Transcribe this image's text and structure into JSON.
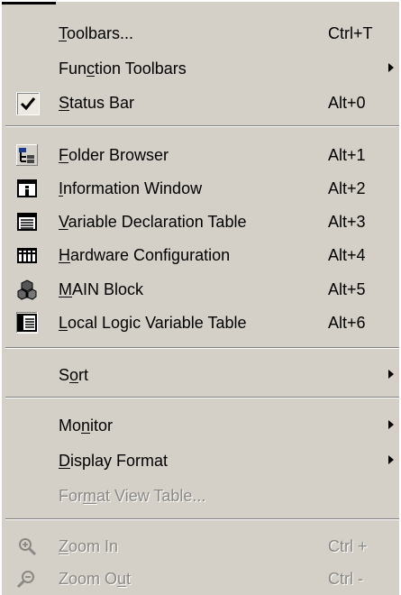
{
  "menu": {
    "items": [
      {
        "pre": "",
        "acc": "T",
        "post": "oolbars...",
        "shortcut": "Ctrl+T"
      },
      {
        "pre": "Fun",
        "acc": "c",
        "post": "tion Toolbars",
        "shortcut": ""
      },
      {
        "pre": "",
        "acc": "S",
        "post": "tatus Bar",
        "shortcut": "Alt+0"
      },
      {
        "pre": "",
        "acc": "F",
        "post": "older Browser",
        "shortcut": "Alt+1"
      },
      {
        "pre": "",
        "acc": "I",
        "post": "nformation Window",
        "shortcut": "Alt+2"
      },
      {
        "pre": "",
        "acc": "V",
        "post": "ariable Declaration Table",
        "shortcut": "Alt+3"
      },
      {
        "pre": "",
        "acc": "H",
        "post": "ardware Configuration",
        "shortcut": "Alt+4"
      },
      {
        "pre": "",
        "acc": "M",
        "post": "AIN Block",
        "shortcut": "Alt+5"
      },
      {
        "pre": "",
        "acc": "L",
        "post": "ocal Logic Variable Table",
        "shortcut": "Alt+6"
      },
      {
        "pre": "S",
        "acc": "o",
        "post": "rt",
        "shortcut": ""
      },
      {
        "pre": "Mo",
        "acc": "n",
        "post": "itor",
        "shortcut": ""
      },
      {
        "pre": "",
        "acc": "D",
        "post": "isplay Format",
        "shortcut": ""
      },
      {
        "pre": "For",
        "acc": "m",
        "post": "at View Table...",
        "shortcut": ""
      },
      {
        "pre": "",
        "acc": "Z",
        "post": "oom In",
        "shortcut": "Ctrl +"
      },
      {
        "pre": "Zoom O",
        "acc": "u",
        "post": "t",
        "shortcut": "Ctrl -"
      }
    ]
  },
  "icons": {
    "status_bar": "checkmark-icon",
    "folder_browser": "folder-tree-icon",
    "information_window": "info-window-icon",
    "variable_declaration_table": "table-icon",
    "hardware_configuration": "hardware-rack-icon",
    "main_block": "cubes-icon",
    "local_logic_variable_table": "local-table-icon",
    "zoom_in": "zoom-in-icon",
    "zoom_out": "zoom-out-icon"
  },
  "colors": {
    "menu_bg": "#d4d0c8",
    "disabled_text": "#8a8884"
  }
}
